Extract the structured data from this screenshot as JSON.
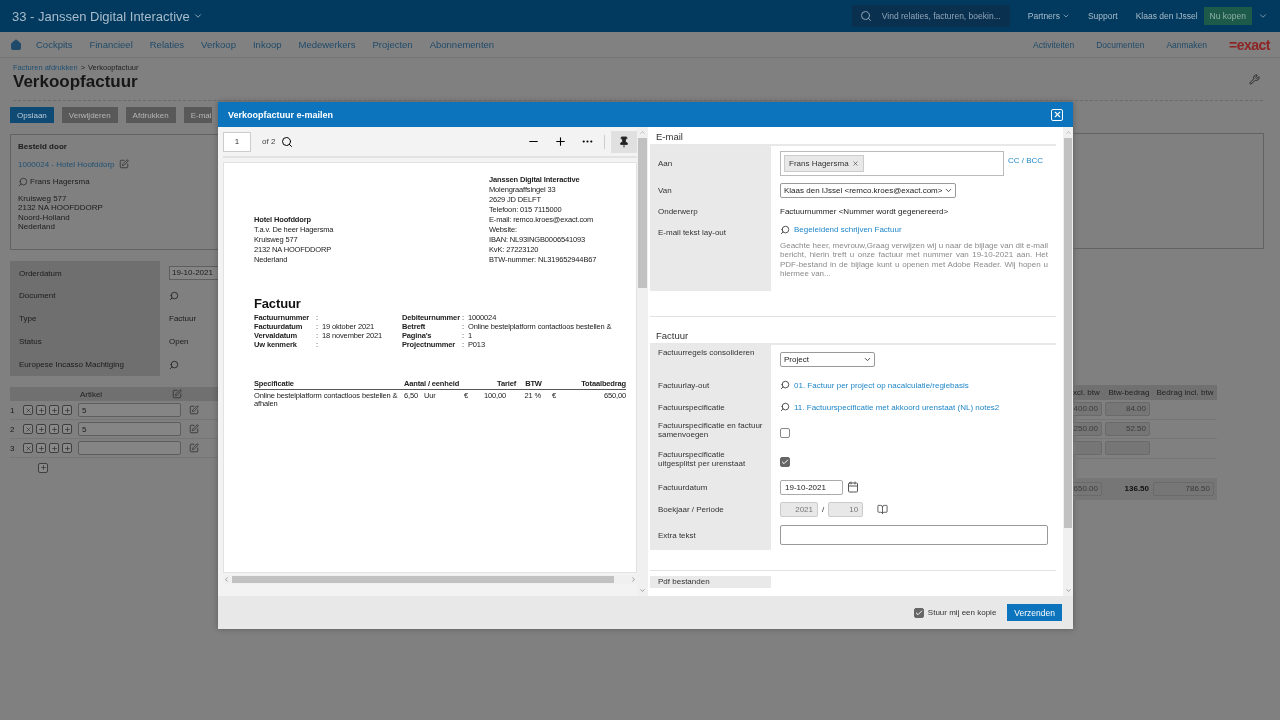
{
  "app_bar": {
    "company": "33 - Janssen Digital Interactive",
    "search": {
      "placeholder": "Vind relaties, facturen, boekin..."
    },
    "links": [
      "Partners",
      "Support"
    ],
    "user": "Klaas den IJssel",
    "buy_button": "Nu kopen"
  },
  "nav": {
    "items": [
      "Cockpits",
      "Financieel",
      "Relaties",
      "Verkoop",
      "Inkoop",
      "Medewerkers",
      "Projecten",
      "Abonnementen"
    ],
    "right_items": [
      "Activiteiten",
      "Documenten",
      "Aanmaken"
    ],
    "logo": "=exact"
  },
  "page": {
    "breadcrumb": {
      "link": "Facturen afdrukken",
      "separator": ">",
      "current": "Verkoopfactuur"
    },
    "title": "Verkoopfactuur",
    "actions": [
      {
        "label": "Opslaan",
        "primary": true
      },
      {
        "label": "Verwijderen",
        "primary": false
      },
      {
        "label": "Afdrukken",
        "primary": false
      },
      {
        "label": "E-mai",
        "primary": false
      }
    ]
  },
  "ordered_by": {
    "heading": "Besteld door",
    "account": "1000024 - Hotel Hoofddorp",
    "contact": "Frans Hagersma",
    "address": [
      "Kruisweg 577",
      "2132 NA HOOFDDORP",
      "Noord-Holland",
      "Nederland"
    ]
  },
  "order_fields": [
    {
      "kind": "field",
      "label": "Orderdatum",
      "value": "19-10-2021"
    },
    {
      "kind": "lookup",
      "label": "Document"
    },
    {
      "kind": "text",
      "label": "Type",
      "value": "Factuur"
    },
    {
      "kind": "text",
      "label": "Status",
      "value": "Open"
    },
    {
      "kind": "lookup",
      "label": "Europese Incasso Machtiging"
    }
  ],
  "lines": {
    "article_column": "Artikel",
    "amount_columns": [
      "xcl. btw",
      "Btw-bedrag",
      "Bedrag incl. btw"
    ],
    "rows": [
      {
        "number": "1",
        "article": "5",
        "excl": "400.00",
        "vat": "84.00"
      },
      {
        "number": "2",
        "article": "5",
        "excl": "250.00",
        "vat": "52.50"
      },
      {
        "number": "3"
      }
    ],
    "totals": {
      "excl": "650.00",
      "vat": "136.50",
      "incl": "786.50"
    }
  },
  "dialog": {
    "title": "Verkoopfactuur e-mailen",
    "pdf_viewer": {
      "page": "1",
      "page_count": "of 2",
      "pinned": true,
      "document": {
        "sender": [
          "Janssen Digital Interactive",
          "Molengraaffsingel 33",
          "2629 JD  DELFT",
          "Telefoon: 015  7115000",
          "E-mail: remco.kroes@exact.com",
          "Website:",
          "IBAN: NL93INGB0006541093",
          "KvK: 27223120",
          "BTW-nummer: NL319652944B67"
        ],
        "recipient": [
          "Hotel Hoofddorp",
          "T.a.v. De heer   Hagersma",
          "Kruisweg 577",
          "2132 NA  HOOFDDORP",
          "Nederland"
        ],
        "title": "Factuur",
        "meta_left": [
          {
            "label": "Factuurnummer",
            "colon": ":"
          },
          {
            "label": "Factuurdatum",
            "colon": ":",
            "value": "19 oktober 2021"
          },
          {
            "label": "Vervaldatum",
            "colon": ":",
            "value": "18 november 2021"
          },
          {
            "label": "Uw kenmerk",
            "colon": ":"
          }
        ],
        "meta_right": [
          {
            "label": "Debiteurnummer",
            "colon": ":",
            "value": "1000024"
          },
          {
            "label": "Betreft",
            "colon": ":",
            "value": "Online bestelplatform contactloos bestellen &"
          },
          {
            "label": "Pagina's",
            "colon": ":",
            "value": "1"
          },
          {
            "label": "Projectnummer",
            "colon": ":",
            "value": "P013"
          }
        ],
        "spec_columns": [
          "Specificatie",
          "Aantal / eenheid",
          "Tarief",
          "BTW",
          "Totaalbedrag"
        ],
        "spec_rows": [
          {
            "description": "Online bestelplatform contactloos bestellen & afhalen",
            "quantity": "6,50",
            "unit": "Uur",
            "currency": "€",
            "rate": "100,00",
            "vat": "21 %",
            "total_currency": "€",
            "total": "650,00"
          }
        ]
      }
    },
    "email": {
      "heading": "E-mail",
      "to": {
        "label": "Aan",
        "recipients": [
          "Frans Hagersma"
        ],
        "cc_link": "CC / BCC"
      },
      "from": {
        "label": "Van",
        "value": "Klaas den IJssel <remco.kroes@exact.com>"
      },
      "subject": {
        "label": "Onderwerp",
        "value": "Factuurnummer <Nummer wordt gegenereerd>"
      },
      "layout": {
        "label": "E-mail tekst lay-out",
        "link": "Begeleidend schrijven Factuur",
        "preview": "Geachte heer, mevrouw,Graag verwijzen wij u naar de bijlage van dit e-mail bericht, hierin treft u onze factuur met nummer  van 19-10-2021 aan. Het PDF-bestand in de bijlage kunt u openen met Adobe Reader. Wij hopen u hiermee van..."
      }
    },
    "invoice": {
      "heading": "Factuur",
      "fields": [
        {
          "kind": "select",
          "label": "Factuurregels consolideren",
          "value": "Project"
        },
        {
          "kind": "lookup",
          "label": "Factuurlay-out",
          "value": "01. Factuur per project op nacalculatie/regiebasis"
        },
        {
          "kind": "lookup",
          "label": "Factuurspecificatie",
          "value": "11. Factuurspecificatie met akkoord urenstaat (NL) notes2"
        },
        {
          "kind": "checkbox",
          "label": "Factuurspecificatie en factuur samenvoegen",
          "checked": false
        },
        {
          "kind": "checkbox",
          "label": "Factuurspecificatie uitgesplitst per urenstaat",
          "checked": true
        },
        {
          "kind": "date",
          "label": "Factuurdatum",
          "value": "19-10-2021"
        },
        {
          "kind": "period",
          "label": "Boekjaar / Periode",
          "year": "2021",
          "separator": "/",
          "period": "10"
        },
        {
          "kind": "textarea",
          "label": "Extra tekst"
        }
      ]
    },
    "next_section": "Pdf bestanden",
    "footer": {
      "copy_label": "Stuur mij een kopie",
      "copy_checked": true,
      "send": "Verzenden"
    }
  }
}
